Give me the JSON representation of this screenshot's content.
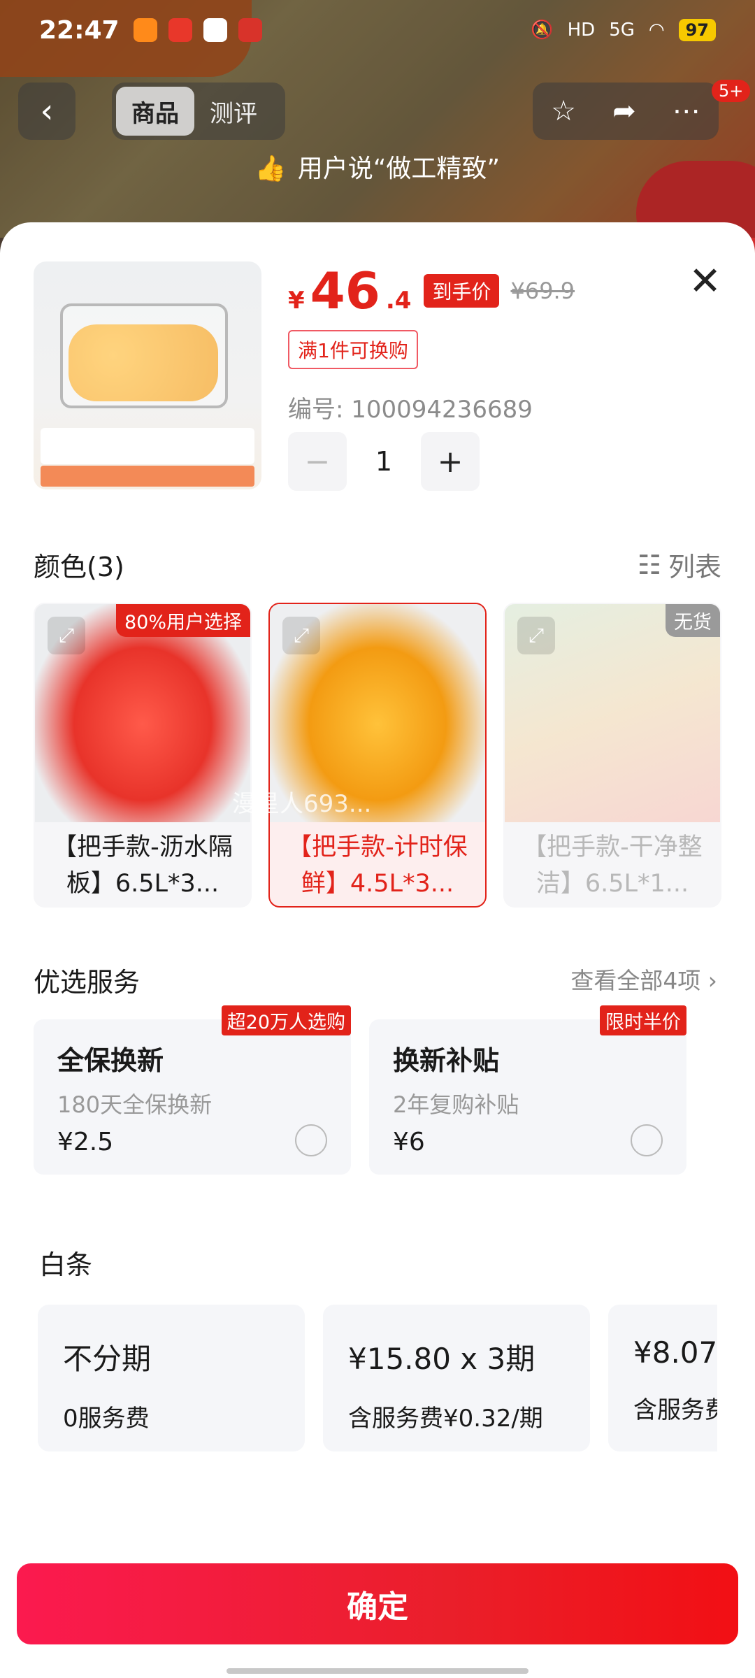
{
  "status_bar": {
    "time": "22:47",
    "network": "5G",
    "hd": "HD",
    "battery": "97"
  },
  "nav": {
    "back_icon": "chevron-left-icon",
    "tabs": [
      "商品",
      "测评"
    ],
    "badge_count": "5+"
  },
  "praise": {
    "text": "用户说“做工精致”"
  },
  "product": {
    "currency": "¥",
    "price_int": "46",
    "price_dec": ".4",
    "final_price_label": "到手价",
    "original_price": "¥69.9",
    "swap_note": "满1件可换购",
    "code": "编号: 100094236689",
    "quantity": "1",
    "minus": "−",
    "plus": "+"
  },
  "color": {
    "title": "颜色(3)",
    "list_toggle": "列表",
    "options": [
      {
        "label": "【把手款-沥水隔板】6.5L*3...",
        "tag": "80%用户选择",
        "selected": false,
        "available": true
      },
      {
        "label": "【把手款-计时保鲜】4.5L*3...",
        "tag": "",
        "selected": true,
        "available": true
      },
      {
        "label": "【把手款-干净整洁】6.5L*1...",
        "tag": "无货",
        "selected": false,
        "available": false
      }
    ]
  },
  "services": {
    "title": "优选服务",
    "view_all": "查看全部4项 ›",
    "items": [
      {
        "name": "全保换新",
        "desc": "180天全保换新",
        "price": "¥2.5",
        "tag": "超20万人选购"
      },
      {
        "name": "换新补贴",
        "desc": "2年复购补贴",
        "price": "¥6",
        "tag": "限时半价"
      }
    ]
  },
  "baitiao": {
    "title": "白条",
    "plans": [
      {
        "main": "不分期",
        "sub": "0服务费"
      },
      {
        "main": "¥15.80 x 3期",
        "sub": "含服务费¥0.32/期"
      },
      {
        "main": "¥8.07",
        "sub": "含服务费"
      }
    ]
  },
  "confirm": {
    "label": "确定"
  },
  "watermark": "漫星人693..."
}
